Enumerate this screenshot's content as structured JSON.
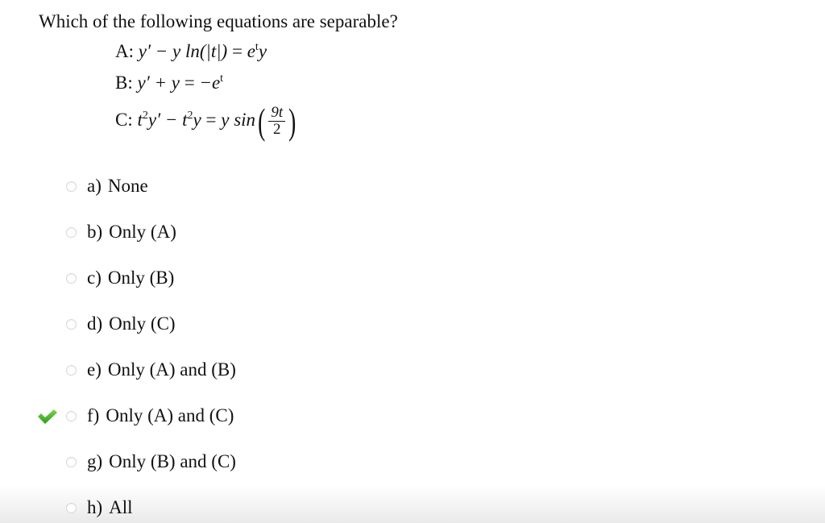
{
  "question": "Which of the following equations are separable?",
  "equations": {
    "A": {
      "label": "A:",
      "lhs": "y′ − y ln(|t|)",
      "rhs": "e",
      "rhs_sup": "t",
      "rhs_tail": "y"
    },
    "B": {
      "label": "B:",
      "lhs": "y′ + y",
      "rhs": "−e",
      "rhs_sup": "t"
    },
    "C": {
      "label": "C:",
      "lhs_a": "t",
      "sup1": "2",
      "lhs_b": "y′ − t",
      "sup2": "2",
      "lhs_c": "y",
      "rhs": "y sin",
      "frac_num": "9t",
      "frac_den": "2"
    }
  },
  "options": [
    {
      "letter": "a)",
      "text": "None"
    },
    {
      "letter": "b)",
      "text": "Only (A)"
    },
    {
      "letter": "c)",
      "text": "Only (B)"
    },
    {
      "letter": "d)",
      "text": "Only (C)"
    },
    {
      "letter": "e)",
      "text": "Only (A) and (B)"
    },
    {
      "letter": "f)",
      "text": "Only (A) and (C)"
    },
    {
      "letter": "g)",
      "text": "Only (B) and (C)"
    },
    {
      "letter": "h)",
      "text": "All"
    }
  ],
  "correct_option": "f)",
  "colors": {
    "check_green": "#4caf2a",
    "radio_border": "#d6d6d6"
  }
}
